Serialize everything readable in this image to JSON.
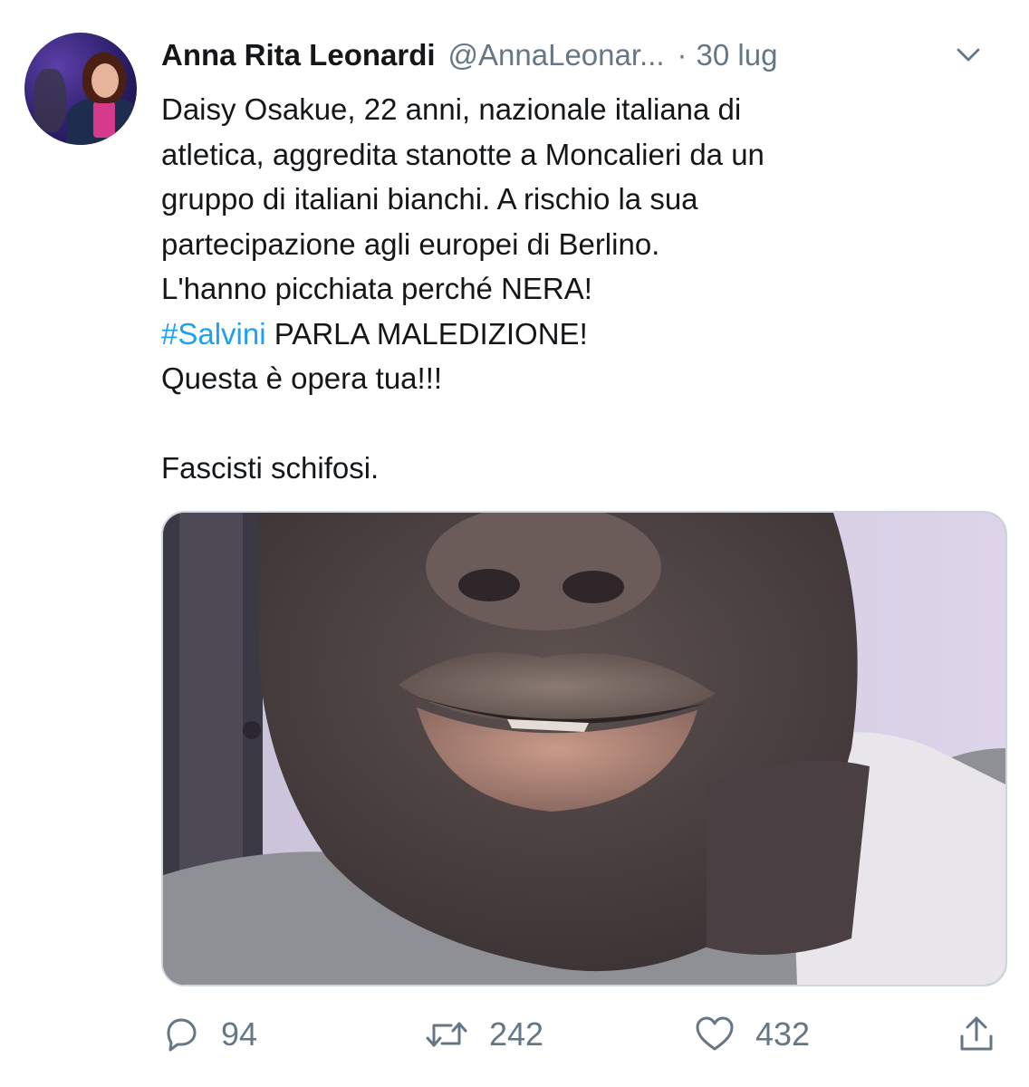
{
  "tweet": {
    "author_name": "Anna Rita Leonardi",
    "author_handle": "@AnnaLeonar...",
    "separator": "·",
    "date": "30 lug",
    "text_lines": {
      "line1": "Daisy Osakue, 22 anni, nazionale italiana di",
      "line2": "atletica, aggredita stanotte a Moncalieri da un",
      "line3": "gruppo di italiani bianchi. A rischio la sua",
      "line4": "partecipazione agli europei di Berlino.",
      "line5": "L'hanno picchiata perché NERA!",
      "hashtag": "#Salvini",
      "line6_rest": " PARLA MALEDIZIONE!",
      "line7": "Questa è opera tua!!!",
      "line8": "Fascisti schifosi."
    },
    "media_description": "photo-close-up-lips",
    "counts": {
      "replies": "94",
      "retweets": "242",
      "likes": "432"
    }
  },
  "icons": {
    "reply": "reply-bubble-icon",
    "retweet": "retweet-arrows-icon",
    "like": "heart-icon",
    "share": "share-upload-icon",
    "menu": "chevron-down-icon"
  },
  "colors": {
    "text": "#14171a",
    "secondary": "#657786",
    "link": "#1da1f2",
    "border": "#ccd6dd"
  }
}
